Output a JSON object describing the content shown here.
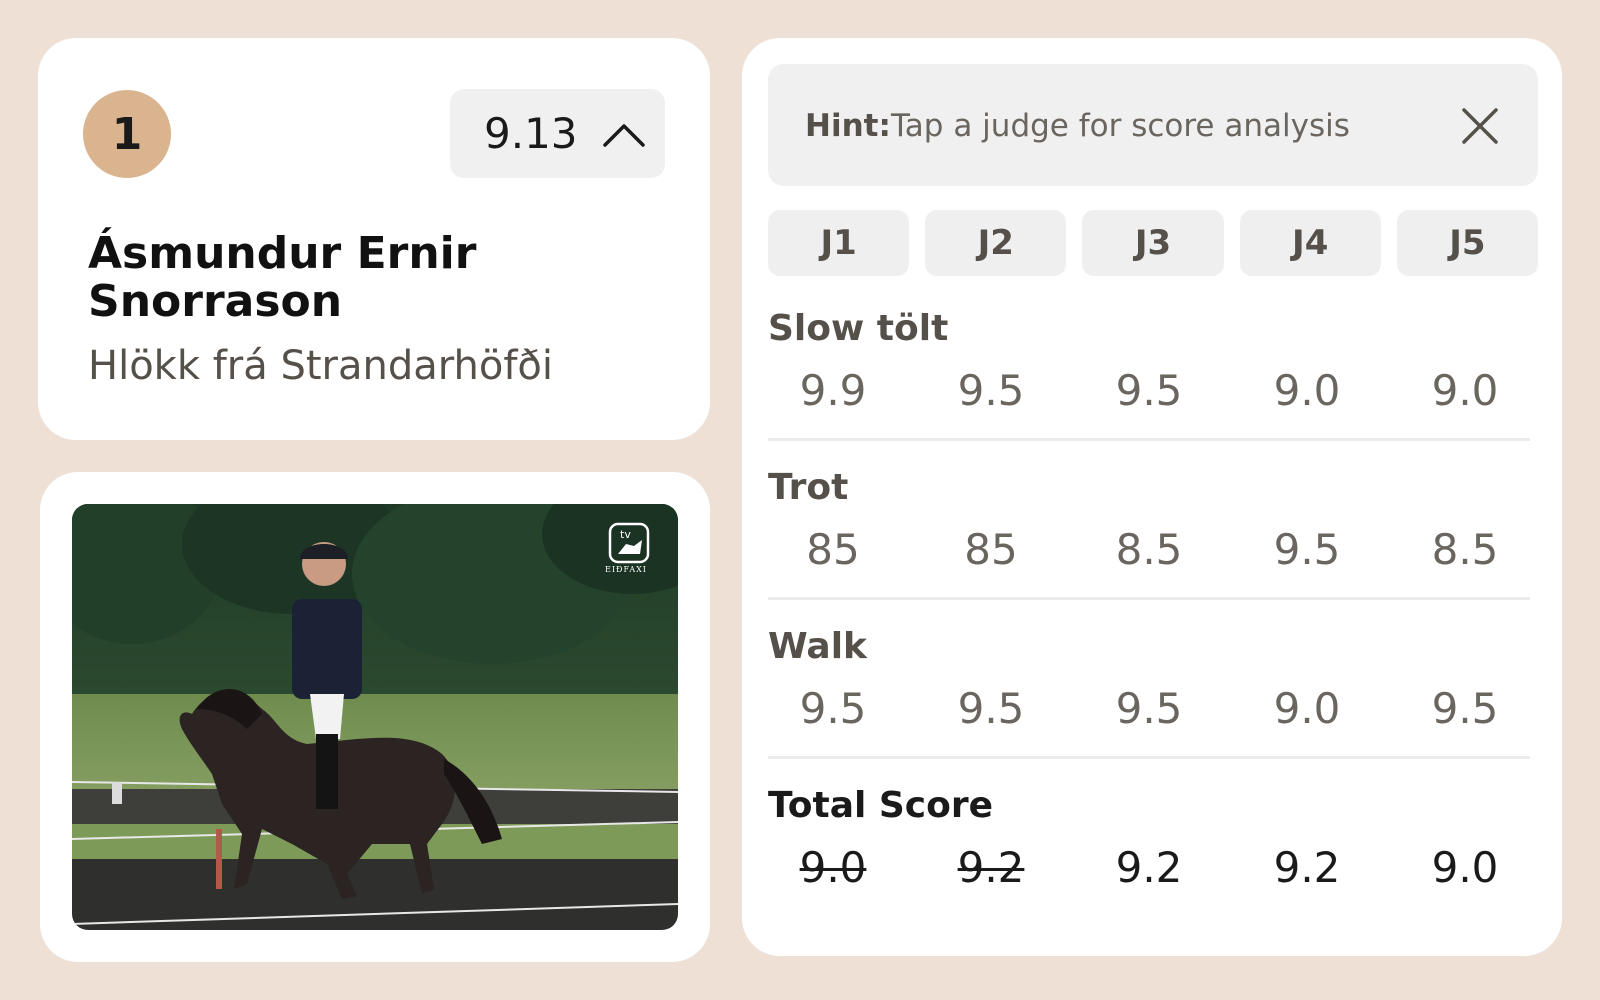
{
  "rider": {
    "rank": "1",
    "score": "9.13",
    "name": "Ásmundur Ernir Snorrason",
    "horse": "Hlökk frá Strandarhöfði"
  },
  "video": {
    "watermark_top": "tv",
    "watermark_bottom": "EIÐFAXI"
  },
  "hint": {
    "label": "Hint:",
    "text": "Tap a judge for score analysis"
  },
  "judges": [
    "J1",
    "J2",
    "J3",
    "J4",
    "J5"
  ],
  "sections": [
    {
      "title": "Slow tölt",
      "scores": [
        "9.9",
        "9.5",
        "9.5",
        "9.0",
        "9.0"
      ],
      "struck": [
        false,
        false,
        false,
        false,
        false
      ]
    },
    {
      "title": "Trot",
      "scores": [
        "85",
        "85",
        "8.5",
        "9.5",
        "8.5"
      ],
      "struck": [
        false,
        false,
        false,
        false,
        false
      ]
    },
    {
      "title": "Walk",
      "scores": [
        "9.5",
        "9.5",
        "9.5",
        "9.0",
        "9.5"
      ],
      "struck": [
        false,
        false,
        false,
        false,
        false
      ]
    },
    {
      "title": "Total Score",
      "scores": [
        "9.0",
        "9.2",
        "9.2",
        "9.2",
        "9.0"
      ],
      "struck": [
        true,
        true,
        false,
        false,
        false
      ]
    }
  ],
  "icons": {
    "score_toggle": "chevron-up-icon",
    "hint_close": "close-icon",
    "video_logo": "horse-logo-icon"
  },
  "colors": {
    "background": "#efe0d6",
    "rank_badge": "#d9b48e",
    "card": "#ffffff",
    "muted_text": "#555049"
  }
}
